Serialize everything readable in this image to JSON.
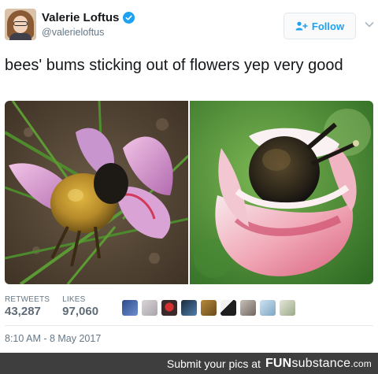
{
  "tweet": {
    "author": {
      "display_name": "Valerie Loftus",
      "handle": "@valerieloftus",
      "verified": true,
      "avatar_icon": "profile-photo"
    },
    "follow_label": "Follow",
    "text": "bees' bums sticking out of flowers yep very good",
    "media": [
      {
        "description_icon": "bee-in-purple-crocus-photo"
      },
      {
        "description_icon": "bee-in-pink-white-flower-photo"
      }
    ],
    "stats": {
      "retweets_label": "RETWEETS",
      "retweets_value": "43,287",
      "likes_label": "LIKES",
      "likes_value": "97,060"
    },
    "likers_count_shown": 9,
    "timestamp": "8:10 AM - 8 May 2017"
  },
  "footer": {
    "text": "Submit your pics at",
    "brand_fun": "FUN",
    "brand_substance": "substance",
    "brand_tld": ".com"
  },
  "colors": {
    "accent": "#1da1f2",
    "secondary_text": "#657786",
    "footer_bg": "#3e3e3e"
  }
}
